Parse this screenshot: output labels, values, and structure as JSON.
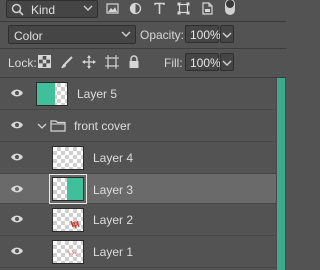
{
  "filter": {
    "kind_label": "Kind",
    "icons": [
      "image-filter-icon",
      "adjustment-filter-icon",
      "type-filter-icon",
      "shape-filter-icon",
      "smart-object-filter-icon",
      "filter-toggle-icon"
    ]
  },
  "blend": {
    "mode": "Color",
    "opacity_label": "Opacity:",
    "opacity_value": "100%"
  },
  "lock": {
    "label": "Lock:",
    "icons": [
      "lock-transparent-pixels-icon",
      "lock-image-pixels-icon",
      "lock-position-icon",
      "lock-artboard-icon",
      "lock-all-icon"
    ],
    "fill_label": "Fill:",
    "fill_value": "100%"
  },
  "layers": [
    {
      "name": "Layer 5",
      "thumb": "green-left",
      "selected": false,
      "indent": 0
    },
    {
      "name": "front cover",
      "type": "group",
      "selected": false,
      "indent": 0
    },
    {
      "name": "Layer 4",
      "thumb": "transparent",
      "selected": false,
      "indent": 1
    },
    {
      "name": "Layer 3",
      "thumb": "green-right",
      "selected": true,
      "indent": 1
    },
    {
      "name": "Layer 2",
      "thumb": "red-marks",
      "selected": false,
      "indent": 1
    },
    {
      "name": "Layer 1",
      "thumb": "red-marks-light",
      "selected": false,
      "indent": 1
    }
  ],
  "colors": {
    "panel_bg": "#535353",
    "selected_bg": "#6a6a6a",
    "accent_green": "#3fbf9a"
  }
}
